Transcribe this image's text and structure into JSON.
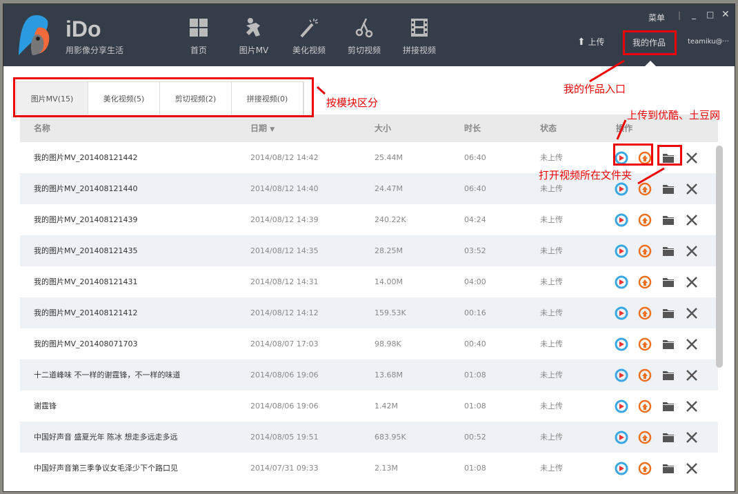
{
  "app": {
    "brand": "iDo",
    "slogan": "用影像分享生活"
  },
  "nav": [
    {
      "label": "首页",
      "icon": "grid-icon"
    },
    {
      "label": "图片MV",
      "icon": "runner-icon"
    },
    {
      "label": "美化视频",
      "icon": "magic-wand-icon"
    },
    {
      "label": "剪切视频",
      "icon": "scissors-icon"
    },
    {
      "label": "拼接视频",
      "icon": "film-icon"
    }
  ],
  "top": {
    "menu": "菜单",
    "upload": "上传",
    "my_works": "我的作品",
    "user": "teamiku@···"
  },
  "tabs": [
    {
      "label": "图片MV(15)"
    },
    {
      "label": "美化视频(5)"
    },
    {
      "label": "剪切视频(2)"
    },
    {
      "label": "拼接视频(0)"
    }
  ],
  "columns": {
    "name": "名称",
    "date": "日期",
    "size": "大小",
    "duration": "时长",
    "status": "状态",
    "ops": "操作"
  },
  "rows": [
    {
      "name": "我的图片MV_201408121442",
      "date": "2014/08/12 14:42",
      "size": "25.44M",
      "duration": "06:40",
      "status": "未上传"
    },
    {
      "name": "我的图片MV_201408121440",
      "date": "2014/08/12 14:40",
      "size": "24.47M",
      "duration": "06:40",
      "status": "未上传"
    },
    {
      "name": "我的图片MV_201408121439",
      "date": "2014/08/12 14:39",
      "size": "240.22K",
      "duration": "04:24",
      "status": "未上传"
    },
    {
      "name": "我的图片MV_201408121435",
      "date": "2014/08/12 14:35",
      "size": "28.25M",
      "duration": "03:52",
      "status": "未上传"
    },
    {
      "name": "我的图片MV_201408121431",
      "date": "2014/08/12 14:31",
      "size": "14.00M",
      "duration": "04:00",
      "status": "未上传"
    },
    {
      "name": "我的图片MV_201408121412",
      "date": "2014/08/12 14:12",
      "size": "159.53K",
      "duration": "00:16",
      "status": "未上传"
    },
    {
      "name": "我的图片MV_201408071703",
      "date": "2014/08/07 17:03",
      "size": "98.98K",
      "duration": "00:40",
      "status": "未上传"
    },
    {
      "name": "十二道峰味 不一样的谢霆锋，不一样的味道",
      "date": "2014/08/06 19:06",
      "size": "13.68M",
      "duration": "01:08",
      "status": "未上传"
    },
    {
      "name": "谢霆锋",
      "date": "2014/08/06 19:06",
      "size": "1.42M",
      "duration": "01:08",
      "status": "未上传"
    },
    {
      "name": "中国好声音 盛夏光年 陈冰 想走多远走多远",
      "date": "2014/08/05 19:51",
      "size": "683.95K",
      "duration": "00:52",
      "status": "未上传"
    },
    {
      "name": "中国好声音第三季争议女毛泽少下个路口见",
      "date": "2014/07/31 09:33",
      "size": "2.13M",
      "duration": "01:08",
      "status": "未上传"
    }
  ],
  "annotations": {
    "tabs": "按模块区分",
    "works": "我的作品入口",
    "upload": "上传到优酷、土豆网",
    "folder": "打开视频所在文件夹"
  },
  "colors": {
    "header": "#353d49",
    "annotation": "#e00000",
    "youku": "#3aa8e0",
    "tudou": "#f07020"
  }
}
